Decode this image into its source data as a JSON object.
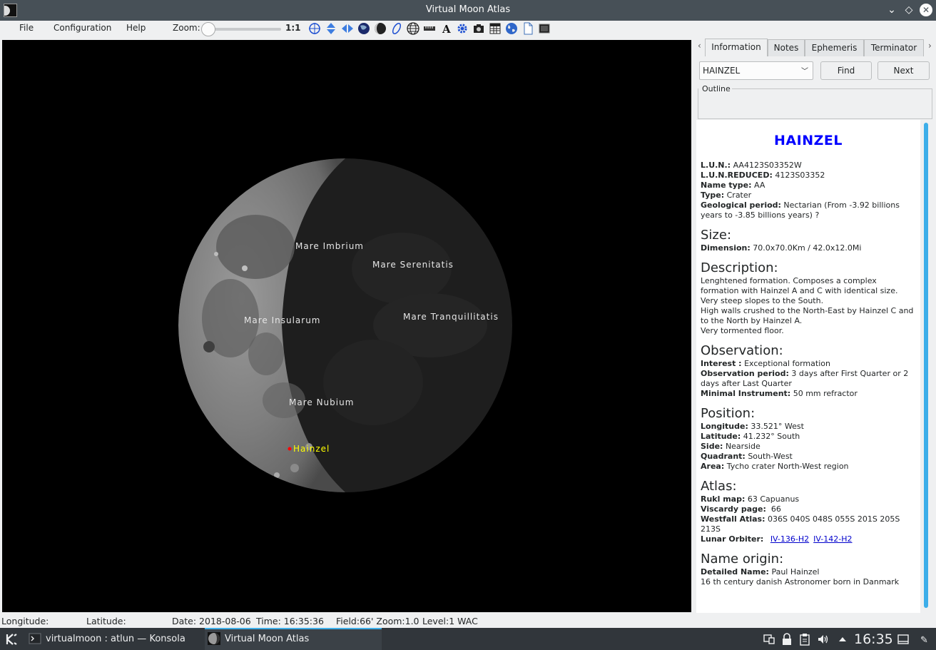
{
  "window": {
    "title": "Virtual Moon Atlas"
  },
  "menu": {
    "file": "File",
    "configuration": "Configuration",
    "help": "Help",
    "zoom_label": "Zoom:",
    "zoom_value": "1:1"
  },
  "map": {
    "labels": [
      "Mare Imbrium",
      "Mare Serenitatis",
      "Mare Insularum",
      "Mare Tranquillitatis",
      "Mare Nubium"
    ],
    "selected_label": "Hainzel"
  },
  "tabs": [
    "Information",
    "Notes",
    "Ephemeris",
    "Terminator"
  ],
  "search": {
    "value": "HAINZEL",
    "find": "Find",
    "next": "Next",
    "outline": "Outline"
  },
  "info": {
    "title": "HAINZEL",
    "lun_label": "L.U.N.:",
    "lun": "AA4123S03352W",
    "lun_reduced_label": "L.U.N.REDUCED:",
    "lun_reduced": "4123S03352",
    "name_type_label": "Name type:",
    "name_type": "AA",
    "type_label": "Type:",
    "type": "Crater",
    "geo_period_label": "Geological period:",
    "geo_period": "Nectarian (From -3.92 billions years to -3.85 billions years) ?",
    "size_heading": "Size:",
    "dimension_label": "Dimension:",
    "dimension": "70.0x70.0Km / 42.0x12.0Mi",
    "description_heading": "Description:",
    "description": [
      "Lenghtened formation. Composes a complex formation with Hainzel A and C with identical size.",
      "Very steep slopes to the South.",
      "High walls crushed to the North-East by Hainzel C and to the North by Hainzel A.",
      "Very tormented floor."
    ],
    "observation_heading": "Observation:",
    "interest_label": "Interest :",
    "interest": "Exceptional formation",
    "obs_period_label": "Observation period:",
    "obs_period": "3 days after First Quarter or 2 days after Last Quarter",
    "instrument_label": "Minimal Instrument:",
    "instrument": "50 mm refractor",
    "position_heading": "Position:",
    "longitude_label": "Longitude:",
    "longitude": "33.521° West",
    "latitude_label": "Latitude:",
    "latitude": "41.232° South",
    "side_label": "Side:",
    "side": "Nearside",
    "quadrant_label": "Quadrant:",
    "quadrant": "South-West",
    "area_label": "Area:",
    "area": "Tycho crater North-West region",
    "atlas_heading": "Atlas:",
    "rukl_label": "Rukl map:",
    "rukl": "63 Capuanus",
    "viscardy_label": "Viscardy page:",
    "viscardy": "66",
    "westfall_label": "Westfall Atlas:",
    "westfall": "036S 040S 048S 055S 201S 205S 213S",
    "orbiter_label": "Lunar Orbiter:",
    "orbiter_links": [
      "IV-136-H2",
      "IV-142-H2"
    ],
    "origin_heading": "Name origin:",
    "detailed_name_label": "Detailed Name:",
    "detailed_name": "Paul Hainzel",
    "origin_text": "16 th century danish Astronomer born in Danmark"
  },
  "status": {
    "longitude": "Longitude:",
    "latitude": "Latitude:",
    "date": "Date: 2018-08-06",
    "time": "Time: 16:35:36",
    "field": "Field:66' Zoom:1.0",
    "level": "Level:1 WAC"
  },
  "taskbar": {
    "tasks": [
      "virtualmoon : atlun — Konsola",
      "Virtual Moon Atlas"
    ],
    "clock": "16:35"
  },
  "colors": {
    "accent": "#3daee9",
    "title_blue": "#0000ff",
    "selected_label": "#ffff00",
    "marker": "#ff0000"
  }
}
